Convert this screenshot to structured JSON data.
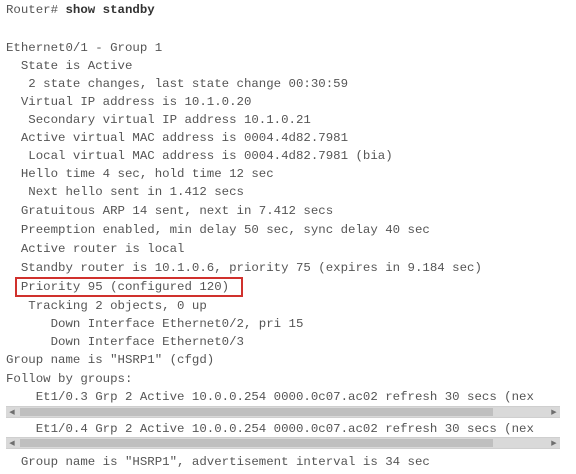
{
  "prompt": "Router#",
  "command": "show standby",
  "lines": [
    "Ethernet0/1 - Group 1",
    "  State is Active",
    "   2 state changes, last state change 00:30:59",
    "  Virtual IP address is 10.1.0.20",
    "   Secondary virtual IP address 10.1.0.21",
    "  Active virtual MAC address is 0004.4d82.7981",
    "   Local virtual MAC address is 0004.4d82.7981 (bia)",
    "  Hello time 4 sec, hold time 12 sec",
    "   Next hello sent in 1.412 secs",
    "  Gratuitous ARP 14 sent, next in 7.412 secs",
    "  Preemption enabled, min delay 50 sec, sync delay 40 sec",
    "  Active router is local",
    "  Standby router is 10.1.0.6, priority 75 (expires in 9.184 sec)",
    "  Priority 95 (configured 120)",
    "   Tracking 2 objects, 0 up",
    "      Down Interface Ethernet0/2, pri 15",
    "      Down Interface Ethernet0/3",
    "Group name is \"HSRP1\" (cfgd)",
    "Follow by groups:",
    "    Et1/0.3 Grp 2 Active 10.0.0.254 0000.0c07.ac02 refresh 30 secs (nex",
    "    Et1/0.4 Grp 2 Active 10.0.0.254 0000.0c07.ac02 refresh 30 secs (nex",
    "  Group name is \"HSRP1\", advertisement interval is 34 sec"
  ],
  "highlighted_line": "  Priority 95 (configured 120)",
  "highlight_color": "#d0312d",
  "scroll_left_icon": "◀",
  "scroll_right_icon": "▶"
}
